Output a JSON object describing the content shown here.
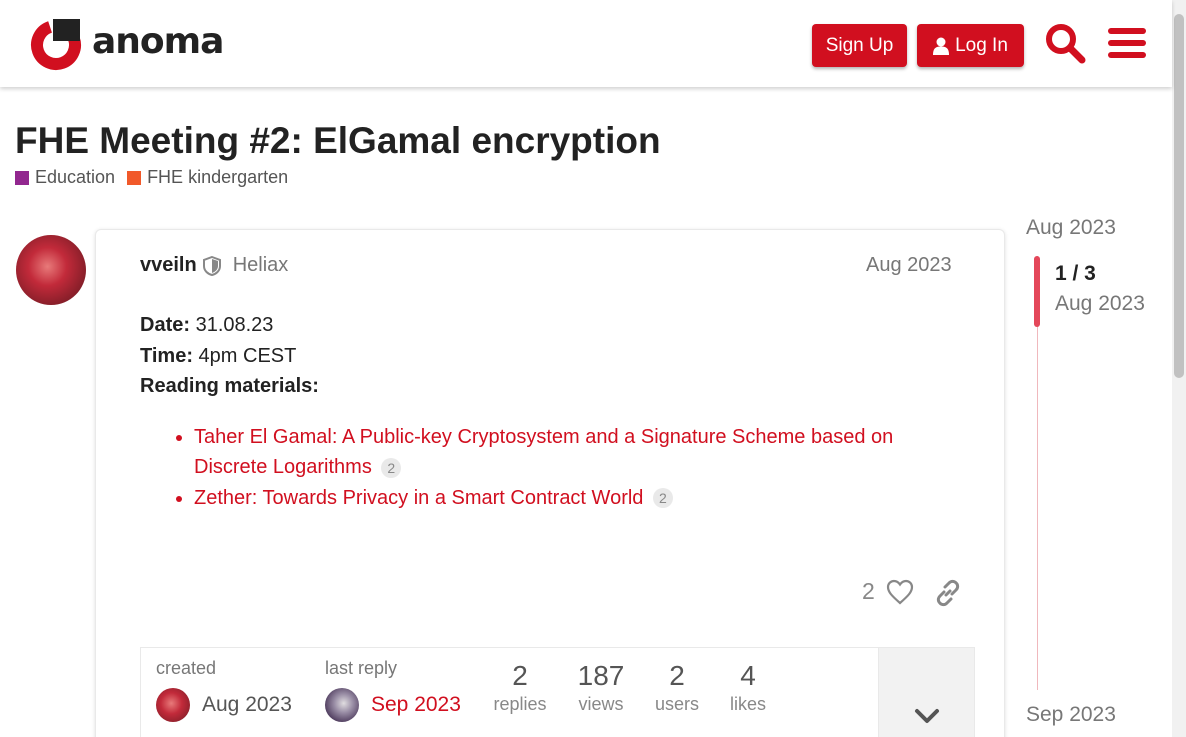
{
  "header": {
    "logo_text": "anoma",
    "signup_label": "Sign Up",
    "login_label": "Log In",
    "search_icon": "search-icon",
    "menu_icon": "hamburger-menu-icon",
    "accent_color": "#d10f1f"
  },
  "topic": {
    "title": "FHE Meeting #2: ElGamal encryption",
    "categories": [
      {
        "label": "Education",
        "color": "#92278f"
      },
      {
        "label": "FHE kindergarten",
        "color": "#f1592a"
      }
    ]
  },
  "post": {
    "username": "vveiln",
    "user_title": "Heliax",
    "date": "Aug 2023",
    "date_label": "Date:",
    "date_value": " 31.08.23",
    "time_label": "Time:",
    "time_value": " 4pm CEST",
    "reading_label": "Reading materials:",
    "links": [
      {
        "text": "Taher El Gamal: A Public-key Cryptosystem and a Signature Scheme based on Discrete Logarithms",
        "clicks": "2"
      },
      {
        "text": "Zether: Towards Privacy in a Smart Contract World",
        "clicks": "2"
      }
    ],
    "like_count": "2"
  },
  "topic_map": {
    "created_label": "created",
    "created_date": "Aug 2023",
    "last_reply_label": "last reply",
    "last_reply_date": "Sep 2023",
    "stats": [
      {
        "num": "2",
        "label": "replies"
      },
      {
        "num": "187",
        "label": "views"
      },
      {
        "num": "2",
        "label": "users"
      },
      {
        "num": "4",
        "label": "likes"
      }
    ]
  },
  "timeline": {
    "start": "Aug 2023",
    "position": "1 / 3",
    "position_date": "Aug 2023",
    "end": "Sep 2023"
  }
}
